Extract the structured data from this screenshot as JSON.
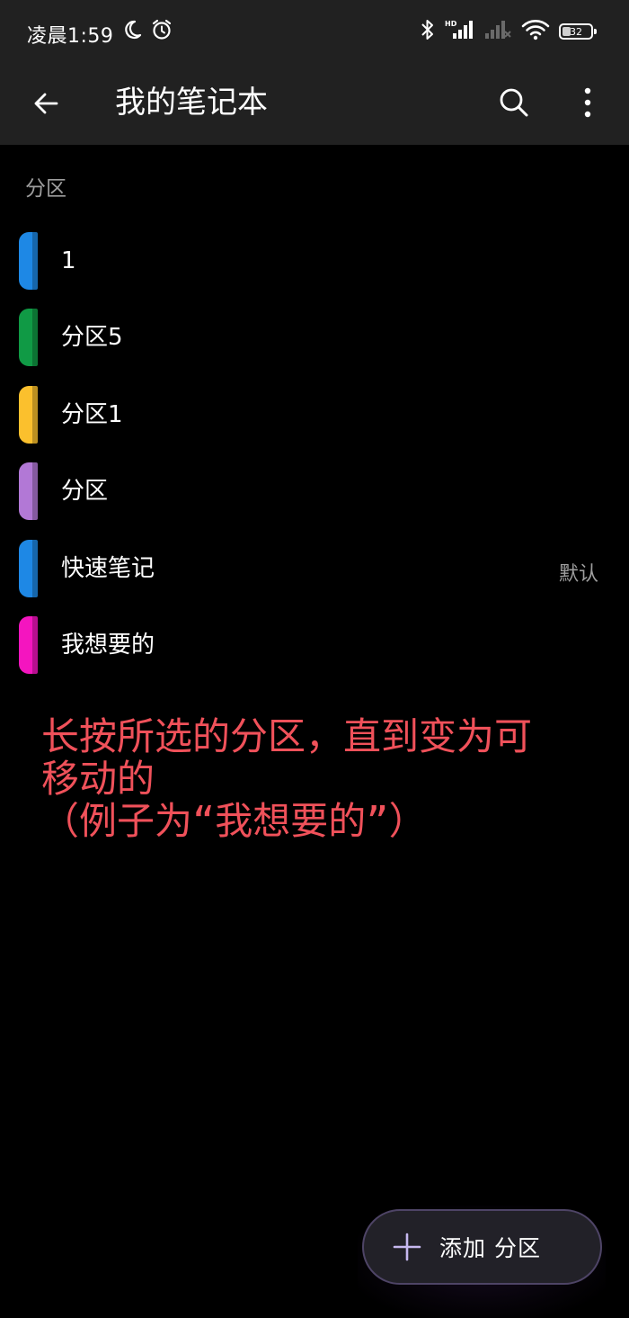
{
  "status_bar": {
    "time": "凌晨1:59",
    "battery": "32",
    "icons": [
      "moon-icon",
      "alarm-icon",
      "bluetooth-icon",
      "hd-signal-icon",
      "signal-icon",
      "wifi-icon",
      "battery-icon"
    ]
  },
  "app_bar": {
    "title": "我的笔记本",
    "back_icon": "arrow-left-icon",
    "search_icon": "search-icon",
    "more_icon": "more-vertical-icon"
  },
  "sections": {
    "header": "分区",
    "items": [
      {
        "label": "1",
        "color": "#1e88e5",
        "default_badge": ""
      },
      {
        "label": "分区5",
        "color": "#109a45",
        "default_badge": ""
      },
      {
        "label": "分区1",
        "color": "#fbc02d",
        "default_badge": ""
      },
      {
        "label": "分区",
        "color": "#b278d6",
        "default_badge": ""
      },
      {
        "label": "快速笔记",
        "color": "#1e88e5",
        "default_badge": "默认"
      },
      {
        "label": "我想要的",
        "color": "#f415bf",
        "default_badge": ""
      }
    ]
  },
  "annotation": {
    "text": "长按所选的分区，直到变为可\n移动的\n（例子为“我想要的”）",
    "color": "#f0515a"
  },
  "fab": {
    "label": "添加 分区",
    "icon": "plus-icon"
  }
}
